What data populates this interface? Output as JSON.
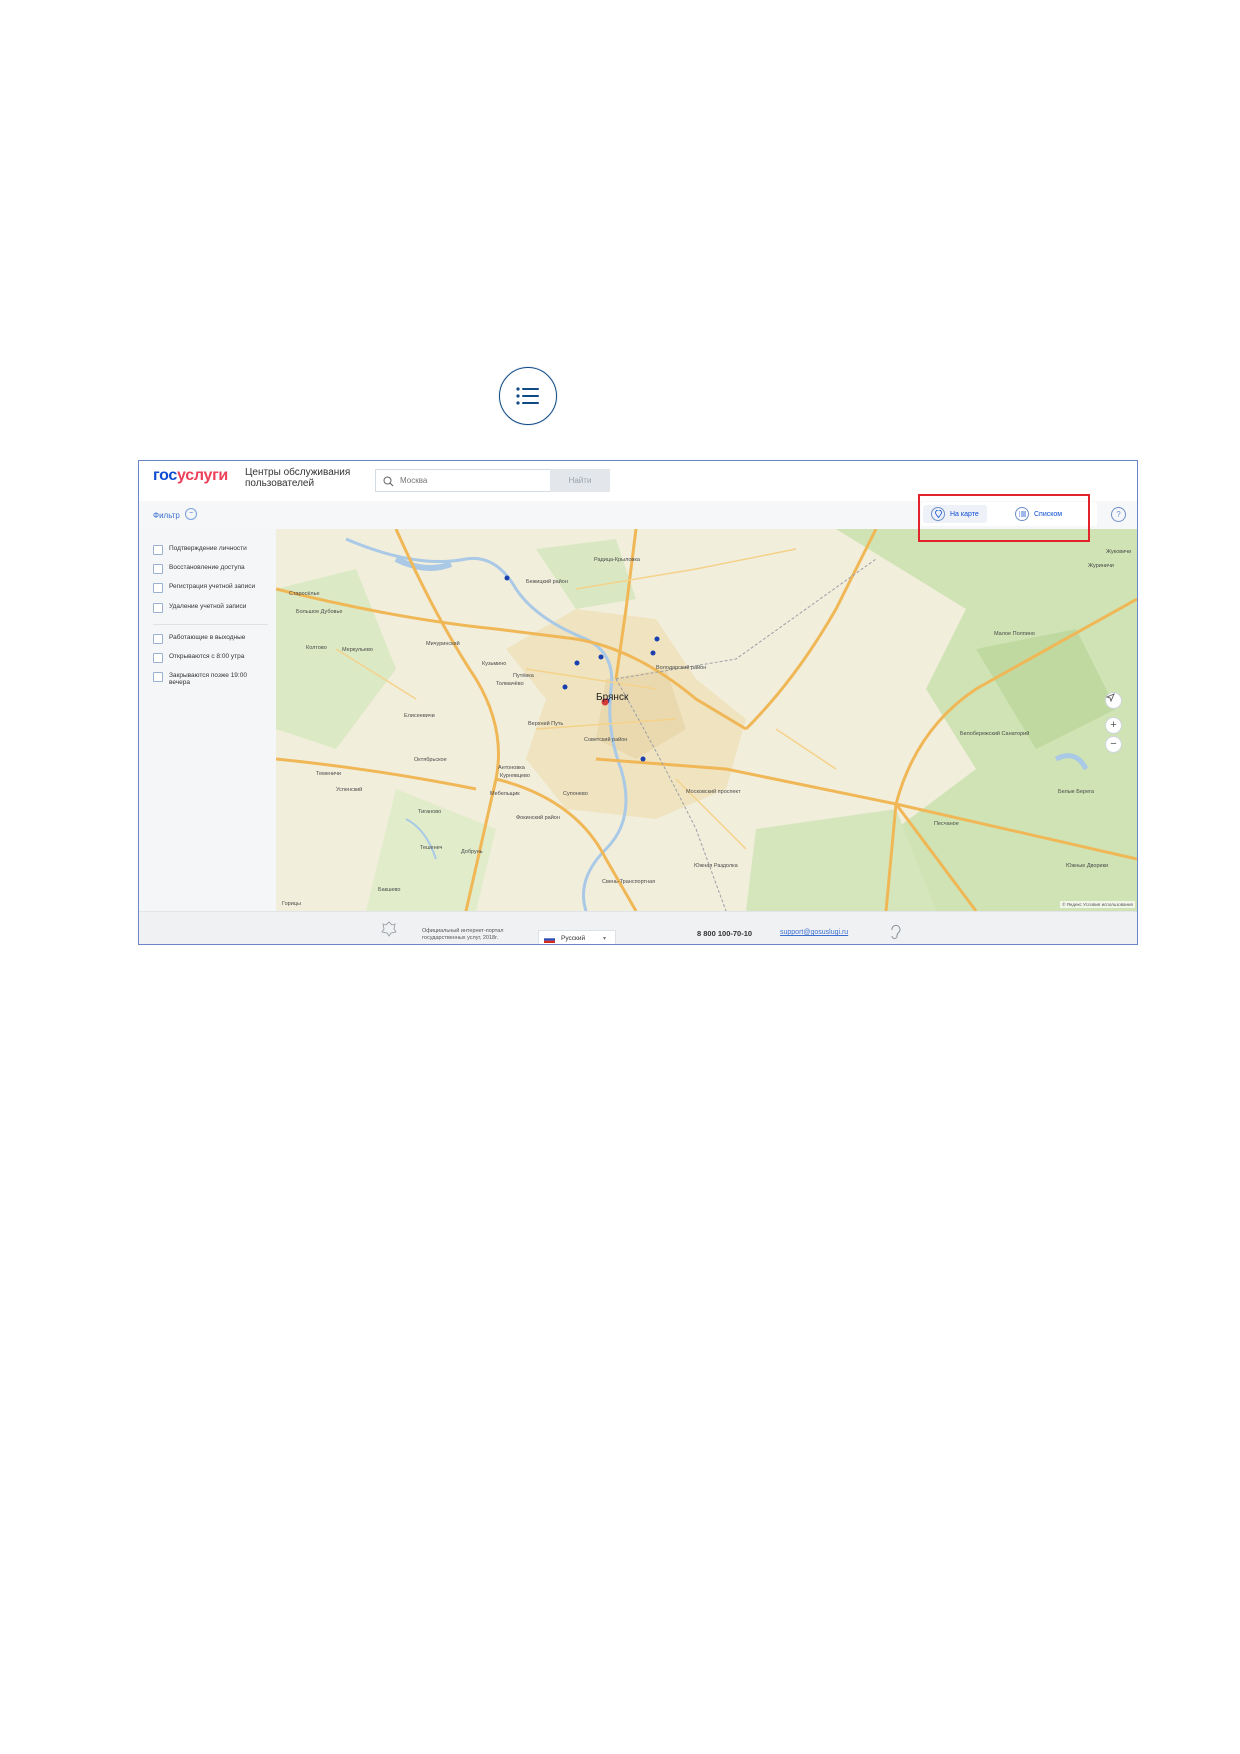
{
  "header": {
    "logo_part1": "гос",
    "logo_part2": "услуги",
    "app_title": "Центры обслуживания пользователей",
    "search_placeholder": "Москва",
    "find_button": "Найти"
  },
  "filter": {
    "label": "Фильтр",
    "options": [
      "Подтверждение личности",
      "Восстановление доступа",
      "Регистрация учетной записи",
      "Удаление учетной записи"
    ],
    "schedule": [
      "Работающие в выходные",
      "Открываются с 8:00 утра",
      "Закрываются позже 19:00 вечера"
    ]
  },
  "view_toggle": {
    "map_label": "На карте",
    "list_label": "Списком",
    "active": "map"
  },
  "map": {
    "city": "Брянск",
    "place_labels": [
      "Радица-Крыловка",
      "Старосёлье",
      "Большое Дубовье",
      "Мичуринский",
      "Кузьмино",
      "Меркульево",
      "Колтово",
      "Путёвка",
      "Толмачёво",
      "Верхний Путь",
      "Елисеевичи",
      "Октябрьское",
      "Антоновка",
      "Курнявцево",
      "Мебельщик",
      "Супонево",
      "Теменичи",
      "Успенский",
      "Тиганово",
      "Тешенеч",
      "Добрунь",
      "Свень-Транспортная",
      "Южная Раздолка",
      "Белые Берега",
      "Жуковичи",
      "Малое Полпино",
      "Белобережский Санаторий",
      "Журиничи",
      "Бакшево",
      "Горицы",
      "Советский район",
      "Бежицкий район",
      "Володарский район",
      "Фокинский район",
      "Московский проспект",
      "Южные Дворики",
      "Песчаное"
    ],
    "copyright": "© Яндекс Условия использования",
    "zoom_in": "+",
    "zoom_out": "−"
  },
  "footer": {
    "portal_text": "Официальный интернет-портал государственных услуг, 2018г.",
    "language": "Русский",
    "phone": "8 800 100-70-10",
    "email": "support@gosuslugi.ru"
  },
  "icons": {
    "list_view": "list-icon",
    "map_view": "map-pin-icon",
    "search": "search-icon",
    "help": "help-icon",
    "locate": "locate-arrow-icon",
    "emblem": "coat-of-arms-icon",
    "accessibility": "ear-icon"
  },
  "colors": {
    "brand_blue": "#0d4cd3",
    "brand_red": "#ee3f58",
    "highlight_red": "#e2232b",
    "marker_blue": "#1a3fae"
  }
}
